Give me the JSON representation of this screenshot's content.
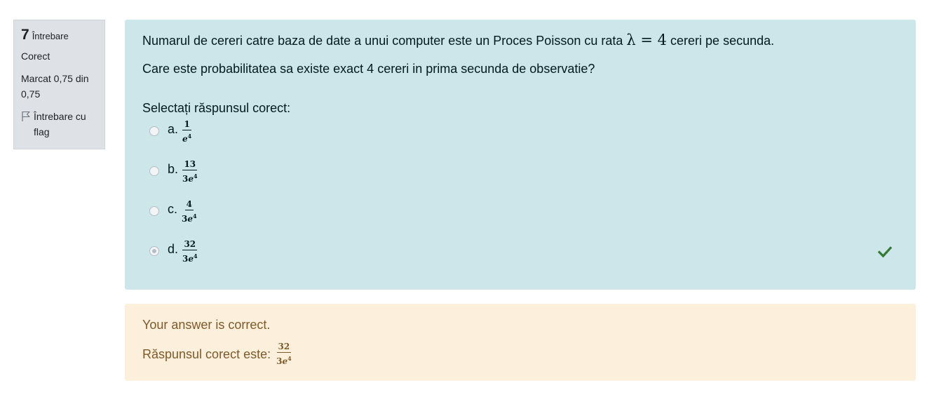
{
  "info": {
    "question_number": "7",
    "question_label": "Întrebare",
    "state": "Corect",
    "grade": "Marcat 0,75 din 0,75",
    "flag_label": "Întrebare cu flag"
  },
  "question": {
    "text_before": "Numarul de cereri catre baza de date a unui computer este un Proces Poisson cu rata",
    "formula": "λ = 4",
    "text_after": "cereri pe secunda.",
    "question_line": "Care este probabilitatea sa existe exact 4 cereri in prima secunda de observatie?",
    "prompt": "Selectați răspunsul corect:",
    "options": [
      {
        "letter": "a.",
        "numerator": "1",
        "den_coef": "",
        "den_base": "e",
        "den_exp": "4",
        "checked": false
      },
      {
        "letter": "b.",
        "numerator": "13",
        "den_coef": "3",
        "den_base": "e",
        "den_exp": "4",
        "checked": false
      },
      {
        "letter": "c.",
        "numerator": "4",
        "den_coef": "3",
        "den_base": "e",
        "den_exp": "4",
        "checked": false
      },
      {
        "letter": "d.",
        "numerator": "32",
        "den_coef": "3",
        "den_base": "e",
        "den_exp": "4",
        "checked": true
      }
    ],
    "correct_icon": "check-icon"
  },
  "feedback": {
    "message": "Your answer is correct.",
    "right_answer_label": "Răspunsul corect este:",
    "right_answer": {
      "numerator": "32",
      "den_coef": "3",
      "den_base": "e",
      "den_exp": "4"
    }
  },
  "colors": {
    "question_bg": "#cce6ea",
    "feedback_bg": "#fcefdc",
    "info_bg": "#dee2e6",
    "check_green": "#357a32"
  }
}
